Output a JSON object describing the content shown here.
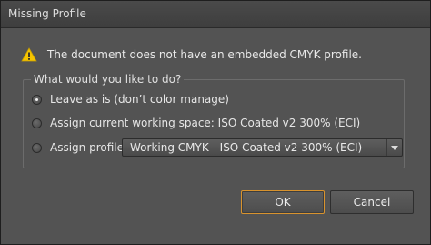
{
  "window": {
    "title": "Missing Profile"
  },
  "message": {
    "icon": "warning-icon",
    "text": "The document does not have an embedded CMYK profile."
  },
  "group": {
    "legend": "What would you like to do?",
    "options": [
      {
        "label": "Leave as is (don’t color manage)",
        "checked": true
      },
      {
        "label": "Assign current working space: ISO Coated v2 300% (ECI)",
        "checked": false
      },
      {
        "label": "Assign profile:",
        "checked": false
      }
    ],
    "profile_select": {
      "value": "Working CMYK - ISO Coated v2 300% (ECI)"
    }
  },
  "buttons": {
    "ok": "OK",
    "cancel": "Cancel"
  },
  "colors": {
    "accent": "#d8932e",
    "warning": "#f5c400"
  }
}
